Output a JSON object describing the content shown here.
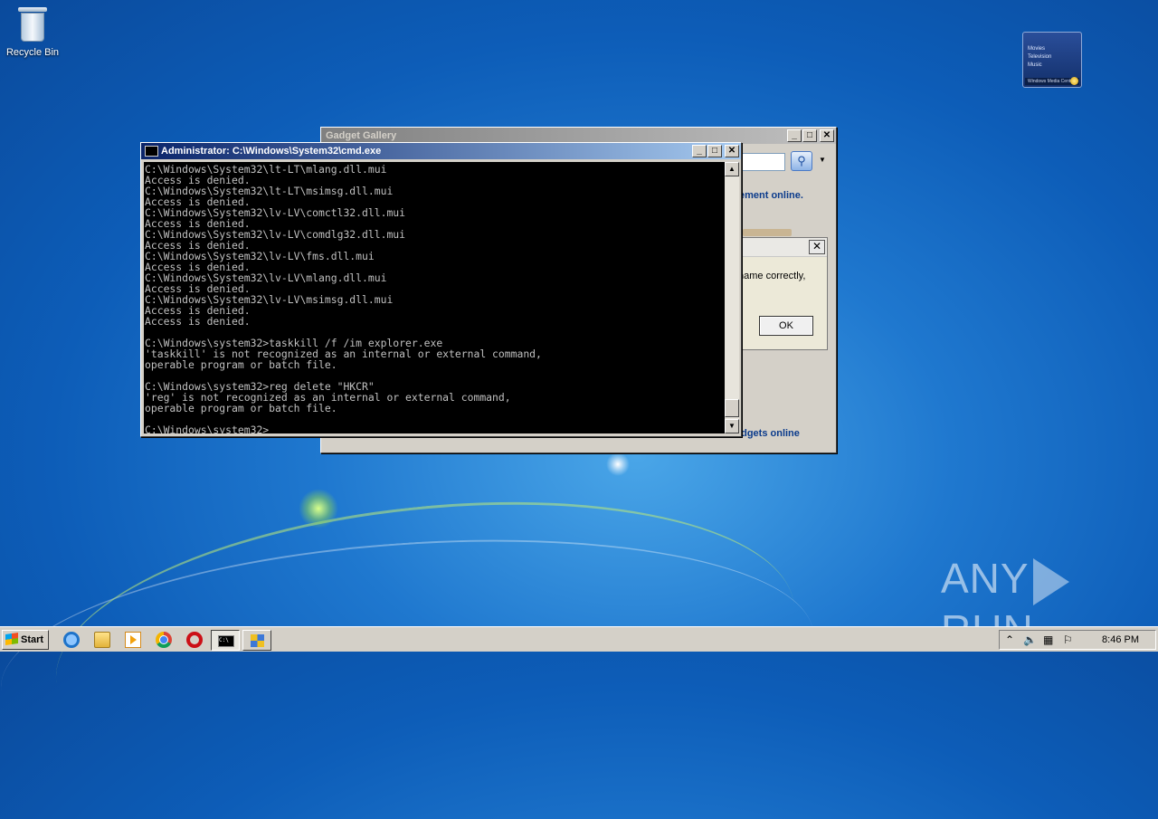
{
  "desktop": {
    "recycle_bin_label": "Recycle Bin",
    "media_gadget": {
      "items": [
        "Movies",
        "Television",
        "Music"
      ],
      "footer": "Windows Media Center"
    },
    "watermark": {
      "left": "ANY",
      "right": "RUN"
    }
  },
  "gadget_gallery": {
    "title": "Gadget Gallery",
    "link_top": "ement online.",
    "link_bottom": "adgets online",
    "dialog": {
      "text": "name correctly,",
      "ok_label": "OK",
      "close_glyph": "✕"
    }
  },
  "cmd_window": {
    "title": "Administrator: C:\\Windows\\System32\\cmd.exe",
    "lines": [
      "C:\\Windows\\System32\\lt-LT\\mlang.dll.mui",
      "Access is denied.",
      "C:\\Windows\\System32\\lt-LT\\msimsg.dll.mui",
      "Access is denied.",
      "C:\\Windows\\System32\\lv-LV\\comctl32.dll.mui",
      "Access is denied.",
      "C:\\Windows\\System32\\lv-LV\\comdlg32.dll.mui",
      "Access is denied.",
      "C:\\Windows\\System32\\lv-LV\\fms.dll.mui",
      "Access is denied.",
      "C:\\Windows\\System32\\lv-LV\\mlang.dll.mui",
      "Access is denied.",
      "C:\\Windows\\System32\\lv-LV\\msimsg.dll.mui",
      "Access is denied.",
      "Access is denied.",
      "",
      "C:\\Windows\\system32>taskkill /f /im explorer.exe",
      "'taskkill' is not recognized as an internal or external command,",
      "operable program or batch file.",
      "",
      "C:\\Windows\\system32>reg delete \"HKCR\"",
      "'reg' is not recognized as an internal or external command,",
      "operable program or batch file.",
      "",
      "C:\\Windows\\system32>"
    ]
  },
  "window_buttons": {
    "minimize": "_",
    "maximize": "□",
    "close": "✕"
  },
  "taskbar": {
    "start_label": "Start",
    "cmd_icon_text": "C:\\",
    "clock": "8:46 PM",
    "tray_icons": [
      "chevron-up-icon",
      "speaker-icon",
      "network-icon",
      "flag-icon"
    ]
  },
  "colors": {
    "desktop_blue": "#1f78cf",
    "active_title": "#0a246a",
    "console_bg": "#000000",
    "console_text": "#c0c0c0"
  }
}
